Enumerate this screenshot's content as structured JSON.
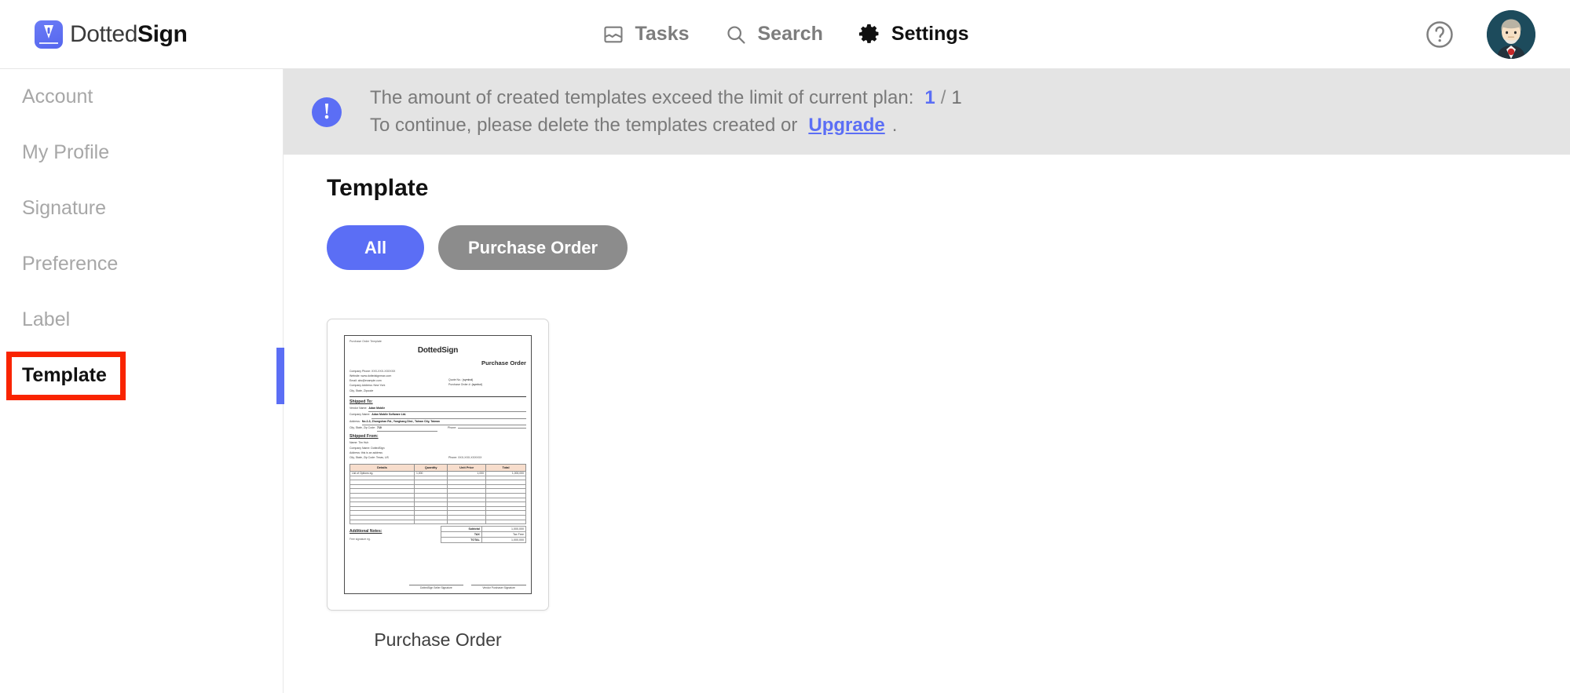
{
  "brand": {
    "name_thin": "Dotted",
    "name_bold": "Sign",
    "logo_icon": "dottedsign-logo-icon"
  },
  "header": {
    "nav": [
      {
        "label": "Tasks",
        "icon": "inbox-icon",
        "active": false
      },
      {
        "label": "Search",
        "icon": "search-icon",
        "active": false
      },
      {
        "label": "Settings",
        "icon": "gear-icon",
        "active": true
      }
    ],
    "help_icon": "help-circle-icon",
    "avatar_icon": "user-avatar"
  },
  "sidebar": {
    "items": [
      {
        "label": "Account",
        "active": false
      },
      {
        "label": "My Profile",
        "active": false
      },
      {
        "label": "Signature",
        "active": false
      },
      {
        "label": "Preference",
        "active": false
      },
      {
        "label": "Label",
        "active": false
      },
      {
        "label": "Template",
        "active": true
      }
    ]
  },
  "banner": {
    "icon": "alert-exclamation-icon",
    "line1_text": "The amount of created templates exceed the limit of current plan:",
    "count_used": "1",
    "count_separator": "/",
    "count_total": "1",
    "line2_prefix": "To continue, please delete the templates created or",
    "upgrade_label": "Upgrade",
    "line2_suffix": "."
  },
  "main": {
    "title": "Template",
    "filters": [
      {
        "label": "All",
        "selected": true
      },
      {
        "label": "Purchase Order",
        "selected": false
      }
    ],
    "templates": [
      {
        "caption": "Purchase Order"
      }
    ]
  },
  "doc_preview": {
    "tag": "Purchase Order Template",
    "brand": "DottedSign",
    "title": "Purchase Order",
    "company": [
      "Company Phone: XXX-XXX-XXXXXX",
      "Website: www.dottedsignmax.com",
      "Email: abc@example.com",
      "Company Address: New York",
      "City, State, Zipcode"
    ],
    "meta": [
      {
        "label": "Quote No.:",
        "value": "(symbol)"
      },
      {
        "label": "Purchase Order #:",
        "value": "(symbol)"
      }
    ],
    "shipped_to_title": "Shipped To:",
    "shipped_to": [
      {
        "label": "Vendor Name:",
        "value": "Adan Mobile"
      },
      {
        "label": "Company Name:",
        "value": "Adan Mobile Software Ltd."
      },
      {
        "label": "Address:",
        "value": "No.2-3, Zhongshan Rd., Yongkang Dist., Tainan City, Taiwan"
      },
      {
        "label": "City, State, Zip Code:",
        "value": "710"
      },
      {
        "label": "Phone:",
        "value": ""
      }
    ],
    "shipped_from_title": "Shipped From:",
    "shipped_from": [
      "Name: Tim Huh",
      "Company Name: DottedSign",
      "Address: this is an address",
      "City, State, Zip Code: Texas, US",
      "Phone: XXX-XXX-XXXXXX"
    ],
    "table_headers": [
      "Details",
      "Quantity",
      "Unit Price",
      "Total"
    ],
    "table_first_row": [
      "List of Options eg.",
      "1,000",
      "1,000",
      "1,000,000"
    ],
    "table_empty_rows": 11,
    "notes_title": "Additional Notes:",
    "notes_text": "Free signature eg.",
    "totals": [
      {
        "label": "Subtotal",
        "value": "1,000,000"
      },
      {
        "label": "TAX",
        "value": "Tax Free"
      },
      {
        "label": "TOTAL",
        "value": "1,000,000"
      }
    ],
    "signatures": [
      "DottedSign Seller Signature",
      "Vendor Purchaser Signature"
    ]
  }
}
